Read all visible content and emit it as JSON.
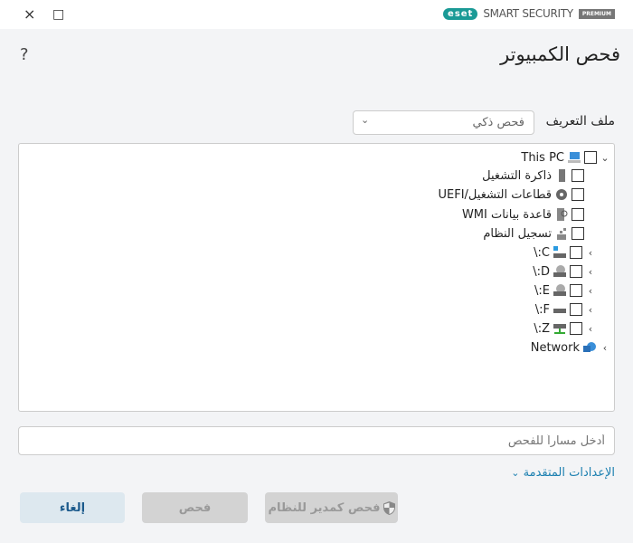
{
  "window": {
    "close_icon": "×",
    "maximize_icon": "□"
  },
  "brand": {
    "logo": "eset",
    "product": "SMART SECURITY",
    "edition": "PREMIUM"
  },
  "header": {
    "title": "فحص الكمبيوتر",
    "help": "?"
  },
  "profile": {
    "label": "ملف التعريف",
    "selected": "فحص ذكي"
  },
  "tree": {
    "root": {
      "label": "This PC"
    },
    "items": [
      {
        "label": "ذاكرة التشغيل",
        "icon": "memory-icon"
      },
      {
        "label": "قطاعات التشغيل/UEFI",
        "icon": "boot-sector-icon"
      },
      {
        "label": "قاعدة بيانات WMI",
        "icon": "wmi-icon"
      },
      {
        "label": "تسجيل النظام",
        "icon": "registry-icon"
      }
    ],
    "drives": [
      {
        "label": "C:\\",
        "icon": "system-drive-icon"
      },
      {
        "label": "D:\\",
        "icon": "optical-drive-icon"
      },
      {
        "label": "E:\\",
        "icon": "optical-drive-icon"
      },
      {
        "label": "F:\\",
        "icon": "drive-icon"
      },
      {
        "label": "Z:\\",
        "icon": "network-drive-icon"
      }
    ],
    "network": {
      "label": "Network"
    }
  },
  "path_input": {
    "placeholder": "أدخل مساراً للفحص"
  },
  "advanced": {
    "label": "الإعدادات المتقدمة"
  },
  "buttons": {
    "cancel": "إلغاء",
    "scan": "فحص",
    "admin_scan": "فحص كمدير للنظام"
  }
}
